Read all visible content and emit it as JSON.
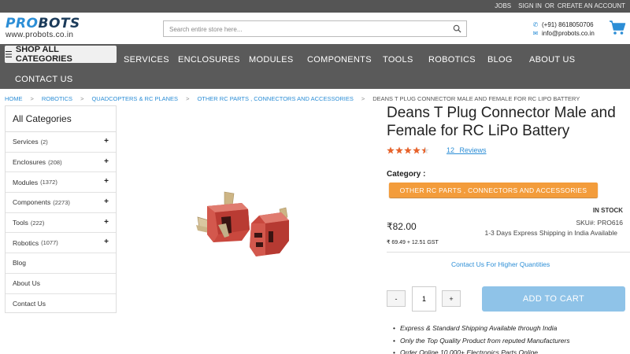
{
  "topbar": {
    "links": [
      "JOBS",
      "SIGN IN",
      "OR",
      "CREATE AN ACCOUNT"
    ]
  },
  "header": {
    "logo_brand_part1": "PRO",
    "logo_brand_part2": "BOTS",
    "logo_url": "www.probots.co.in",
    "search_placeholder": "Search entire store here...",
    "phone": "(+91) 8618050706",
    "email": "info@probots.co.in",
    "icons": [
      "search-icon",
      "phone-icon",
      "mail-icon",
      "cart-icon"
    ]
  },
  "nav": {
    "shop_all": "SHOP ALL CATEGORIES",
    "items": [
      "SERVICES",
      "ENCLOSURES",
      "MODULES",
      "COMPONENTS",
      "TOOLS",
      "ROBOTICS",
      "BLOG",
      "ABOUT US",
      "CONTACT US"
    ]
  },
  "breadcrumb": {
    "items": [
      "HOME",
      "ROBOTICS",
      "QUADCOPTERS & RC PLANES",
      "OTHER RC PARTS , CONNECTORS AND ACCESSORIES"
    ],
    "separator": ">",
    "current": "DEANS T PLUG CONNECTOR MALE AND FEMALE FOR RC LIPO BATTERY"
  },
  "sidebar": {
    "title": "All Categories",
    "items": [
      {
        "label": "Services",
        "count": "(2)",
        "expand": "+"
      },
      {
        "label": "Enclosures",
        "count": "(208)",
        "expand": "+"
      },
      {
        "label": "Modules",
        "count": "(1372)",
        "expand": "+"
      },
      {
        "label": "Components",
        "count": "(2273)",
        "expand": "+"
      },
      {
        "label": "Tools",
        "count": "(222)",
        "expand": "+"
      },
      {
        "label": "Robotics",
        "count": "(1077)",
        "expand": "+"
      },
      {
        "label": "Blog",
        "count": "",
        "expand": ""
      },
      {
        "label": "About Us",
        "count": "",
        "expand": ""
      },
      {
        "label": "Contact Us",
        "count": "",
        "expand": ""
      }
    ]
  },
  "product": {
    "title": "Deans T Plug Connector Male and Female for RC LiPo Battery",
    "rating": 4.5,
    "rating_max": 5,
    "reviews": "12 Reviews",
    "category_label": "Category :",
    "category": "OTHER RC PARTS , CONNECTORS AND ACCESSORIES",
    "stock": "IN STOCK",
    "price": "₹82.00",
    "gst": "₹ 69.49 + 12.51 GST",
    "sku": "SKU#:  PRO616",
    "shipping": "1-3 Days Express Shipping in India Available",
    "contact_qty": "Contact Us For Higher Quantities",
    "qty_minus": "-",
    "qty_value": "1",
    "qty_plus": "+",
    "add_to_cart": "ADD TO CART",
    "bullets": [
      "Express & Standard Shipping Available through India",
      "Only the Top Quality Product from reputed Manufacturers",
      "Order Online 10,000+ Electronics Parts Online"
    ]
  },
  "colors": {
    "accent_blue": "#2c8ed6",
    "nav_bg": "#5a5a5a",
    "category_orange": "#f39c3b",
    "star_orange": "#e8632b",
    "add_to_cart_blue": "#8fc3e8"
  }
}
